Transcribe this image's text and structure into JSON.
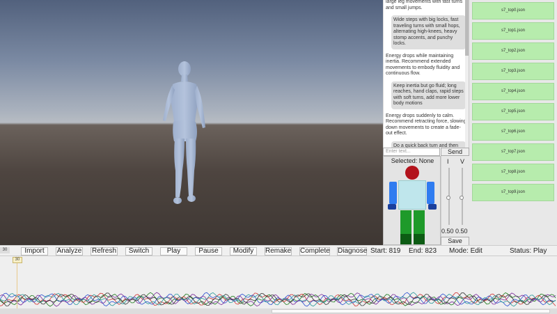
{
  "chat": {
    "messages": [
      {
        "role": "ai",
        "text": "large leg movements with fast turns and small jumps."
      },
      {
        "role": "user",
        "text": "Wide steps with big locks, fast traveling turns with small hops, alternating high-knees, heavy stomp accents, and punchy locks."
      },
      {
        "role": "ai",
        "text": "Energy drops while maintaining inertia. Recommend extended movements to embody fluidity and continuous flow."
      },
      {
        "role": "user",
        "text": "Keep inertia but go fluid; long reaches, hand claps, rapid steps with soft turns, add more lower body motions"
      },
      {
        "role": "ai",
        "text": "Energy drops suddenly to calm. Recommend retracting force, slowing down movements to create a fade-out effect."
      },
      {
        "role": "user",
        "text": "Do a quick back turn and then shrink the steps, slow the points, slower both upper and lower body motion speed."
      }
    ],
    "input_placeholder": "Enter text...",
    "send_label": "Send"
  },
  "selection": {
    "label": "Selected: None",
    "colors": {
      "head": "#b3131c",
      "torso": "#bfe6ec",
      "arms": "#2f7cf0",
      "hands": "#1a3f9c",
      "legs": "#1e9a2a",
      "feet": "#0d5c14"
    }
  },
  "sliders": {
    "s1": {
      "label": "I",
      "value": "0.50"
    },
    "s2": {
      "label": "V",
      "value": "0.50"
    },
    "save_label": "Save"
  },
  "files": [
    "s7_top0.json",
    "s7_top1.json",
    "s7_top2.json",
    "s7_top3.json",
    "s7_top4.json",
    "s7_top5.json",
    "s7_top6.json",
    "s7_top7.json",
    "s7_top8.json",
    "s7_top9.json"
  ],
  "toolbar": {
    "frame_tag": "30",
    "buttons": [
      "Import",
      "Analyze",
      "Refresh",
      "Switch",
      "Play",
      "Pause",
      "Modify",
      "Remake",
      "Complete",
      "Diagnose"
    ],
    "start": "Start: 819",
    "end": "End: 823",
    "mode": "Mode: Edit",
    "status": "Status: Play"
  },
  "timeline": {
    "marker": "30"
  }
}
